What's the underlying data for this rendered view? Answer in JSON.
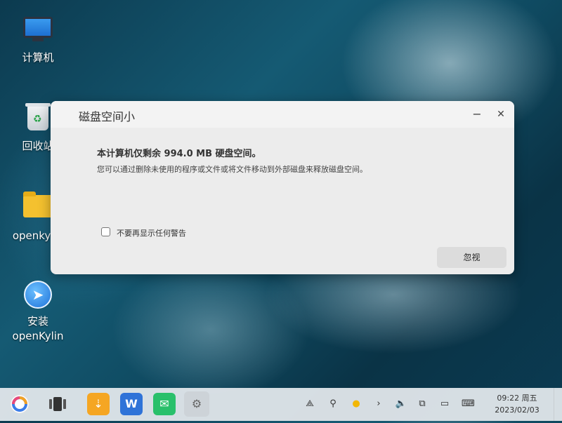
{
  "desktop": {
    "icons": [
      {
        "label": "计算机",
        "icon": "computer-icon"
      },
      {
        "label": "回收站",
        "icon": "trash-icon"
      },
      {
        "label": "openkylin",
        "icon": "folder-icon"
      },
      {
        "label_line1": "安装",
        "label_line2": "openKylin",
        "icon": "installer-icon"
      }
    ]
  },
  "dialog": {
    "title": "磁盘空间小",
    "heading": "本计算机仅剩余 994.0 MB 硬盘空间。",
    "message": "您可以通过删除未使用的程序或文件或将文件移动到外部磁盘来释放磁盘空间。",
    "checkbox_label": "不要再显示任何警告",
    "checkbox_checked": false,
    "ignore_button": "忽视",
    "minimize_glyph": "−",
    "close_glyph": "✕"
  },
  "taskbar": {
    "apps": [
      "start-menu-icon",
      "multitask-view-icon",
      "software-store-icon",
      "wps-office-icon",
      "message-app-icon",
      "settings-icon"
    ],
    "tray": [
      "network-icon",
      "search-icon",
      "night-mode-icon",
      "expand-tray-icon",
      "volume-icon",
      "clipboard-icon",
      "notification-icon",
      "keyboard-icon"
    ],
    "clock": {
      "time": "09:22 周五",
      "date": "2023/02/03"
    }
  }
}
